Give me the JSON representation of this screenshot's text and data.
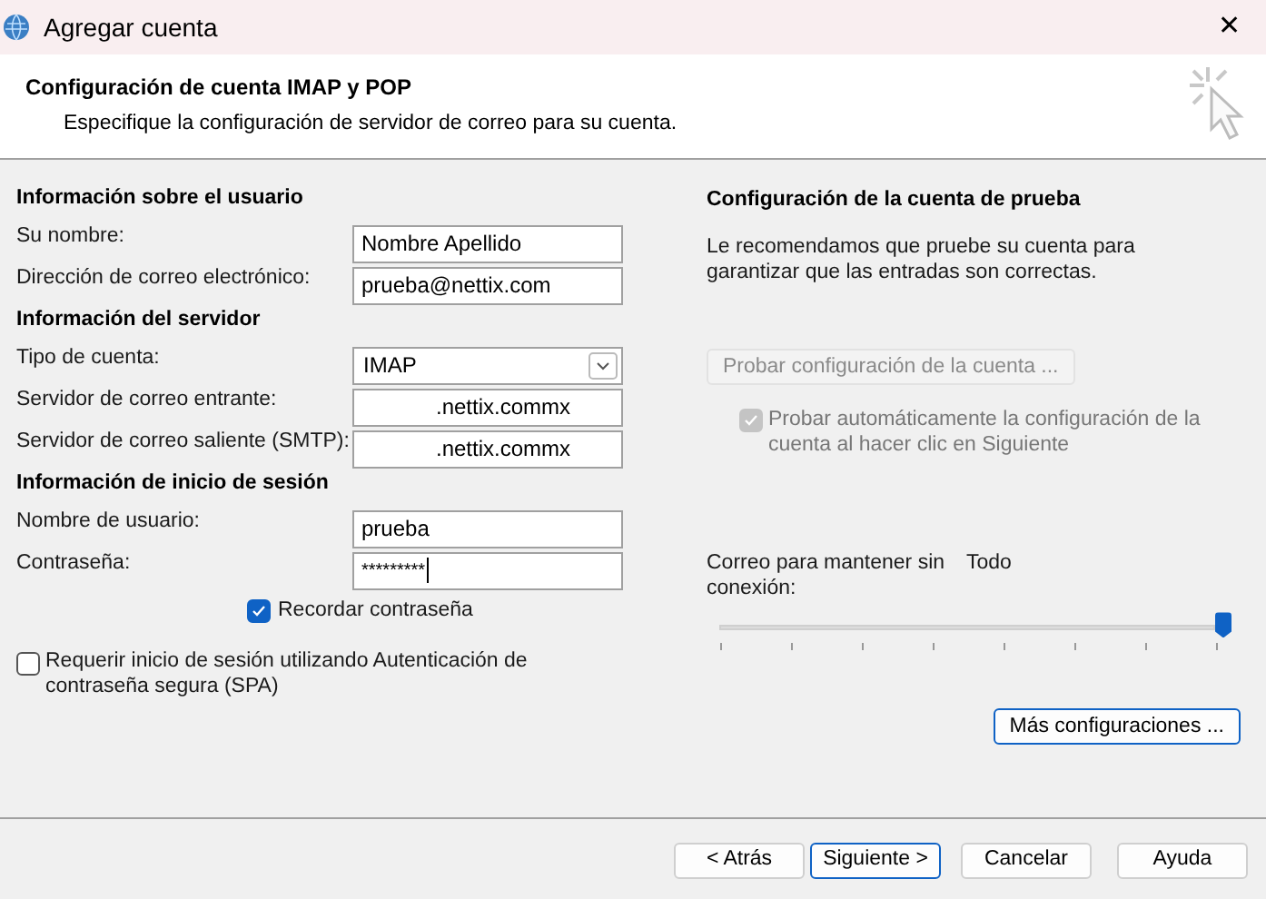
{
  "window": {
    "title": "Agregar cuenta",
    "close": "✕"
  },
  "header": {
    "title": "Configuración de cuenta IMAP y POP",
    "subtitle": "Especifique la configuración de servidor de correo para su cuenta."
  },
  "sections": [
    {
      "title": "Información sobre el usuario",
      "fields": [
        {
          "label": "Su nombre:",
          "value": "Nombre Apellido",
          "kind": "text"
        },
        {
          "label": "Dirección de correo electrónico:",
          "value": "prueba@nettix.com",
          "kind": "text"
        }
      ]
    },
    {
      "title": "Información del servidor",
      "fields": [
        {
          "label": "Tipo de cuenta:",
          "value": "IMAP",
          "kind": "select"
        },
        {
          "label": "Servidor de correo entrante:",
          "value": ".nettix.commx",
          "kind": "server"
        },
        {
          "label": "Servidor de correo saliente (SMTP):",
          "value": ".nettix.commx",
          "kind": "server"
        }
      ]
    },
    {
      "title": "Información de inicio de sesión",
      "fields": [
        {
          "label": "Nombre de usuario:",
          "value": "prueba",
          "kind": "text"
        },
        {
          "label": "Contraseña:",
          "value": "*********",
          "kind": "password",
          "focused": true
        }
      ]
    }
  ],
  "remember_password": {
    "label": "Recordar contraseña",
    "checked": true
  },
  "spa": {
    "label": "Requerir inicio de sesión utilizando Autenticación de contraseña segura (SPA)",
    "checked": false
  },
  "test": {
    "title": "Configuración de la cuenta de prueba",
    "description": "Le recomendamos que pruebe su cuenta para garantizar que las entradas son correctas.",
    "button": {
      "label": "Probar configuración de la cuenta ...",
      "disabled": true
    },
    "auto_test": {
      "label": "Probar automáticamente la configuración de la cuenta al hacer clic en Siguiente",
      "checked": true,
      "disabled": true
    }
  },
  "offline": {
    "label": "Correo para mantener sin conexión:",
    "reading": "Todo",
    "level": 1
  },
  "more_button": {
    "label": "Más configuraciones ..."
  },
  "buttons": [
    {
      "label": "< Atrás",
      "selected": false
    },
    {
      "label": "Siguiente >",
      "selected": true
    },
    {
      "label": "Cancelar",
      "selected": false
    },
    {
      "label": "Ayuda",
      "selected": false
    }
  ]
}
